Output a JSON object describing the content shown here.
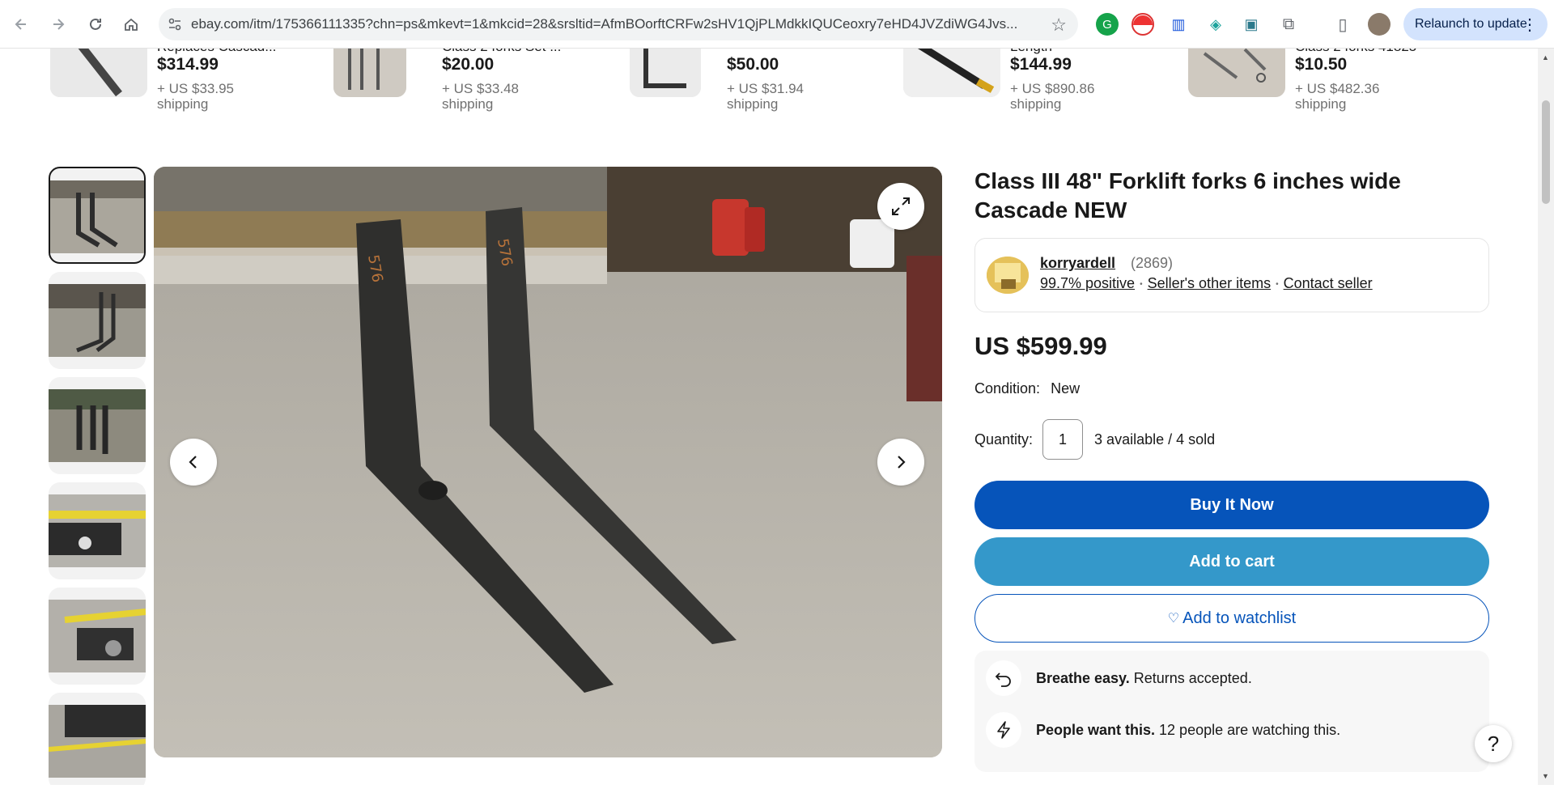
{
  "browser": {
    "url": "ebay.com/itm/175366111335?chn=ps&mkevt=1&mkcid=28&srsltid=AfmBOorftCRFw2sHV1QjPLMdkkIQUCeoxry7eHD4JVZdiWG4Jvs...",
    "relaunch_label": "Relaunch to update"
  },
  "related": [
    {
      "title": "Replaces Cascad...",
      "price": "$314.99",
      "shipping": "+ US $33.95 shipping"
    },
    {
      "title": "Class 2 forks Set ...",
      "price": "$20.00",
      "shipping": "+ US $33.48 shipping"
    },
    {
      "title": "",
      "price": "$50.00",
      "shipping": "+ US $31.94 shipping"
    },
    {
      "title": "Length",
      "price": "$144.99",
      "shipping": "+ US $890.86 shipping"
    },
    {
      "title": "Class 2 forks 41825",
      "price": "$10.50",
      "shipping": "+ US $482.36 shipping"
    }
  ],
  "listing": {
    "title": "Class III 48\" Forklift forks 6 inches wide Cascade NEW",
    "seller": {
      "name": "korryardell",
      "count": "(2869)",
      "positive": "99.7% positive",
      "other_items": "Seller's other items",
      "contact": "Contact seller"
    },
    "price": "US $599.99",
    "condition_label": "Condition:",
    "condition_value": "New",
    "quantity_label": "Quantity:",
    "quantity_value": "1",
    "availability": "3 available / 4 sold",
    "buy_now": "Buy It Now",
    "add_to_cart": "Add to cart",
    "watchlist": "Add to watchlist",
    "returns_bold": "Breathe easy.",
    "returns_text": "Returns accepted.",
    "watch_bold": "People want this.",
    "watch_text": "12 people are watching this."
  },
  "colors": {
    "buy": "#0654ba",
    "cart": "#3498ca",
    "relaunch": "#d3e3fd"
  },
  "icons": [
    "back-icon",
    "forward-icon",
    "reload-icon",
    "home-icon",
    "site-info-icon",
    "star-icon",
    "extensions-icon",
    "expand-icon",
    "chevron-left-icon",
    "chevron-right-icon",
    "heart-icon",
    "return-icon",
    "lightning-icon",
    "help-icon"
  ],
  "help_label": "?"
}
